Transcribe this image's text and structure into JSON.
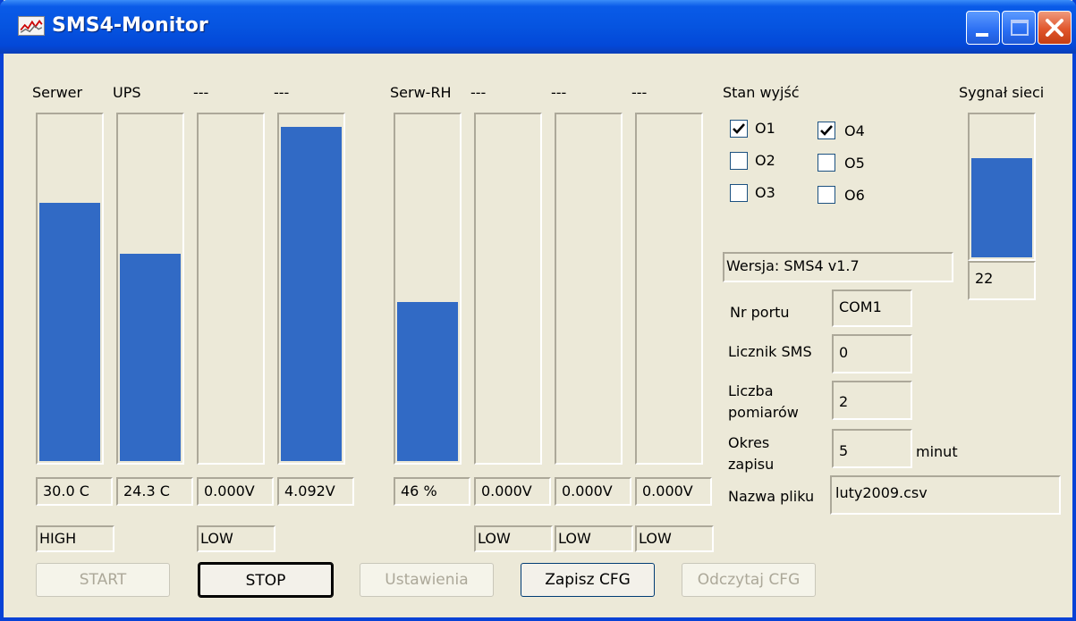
{
  "window": {
    "title": "SMS4-Monitor"
  },
  "channels": [
    {
      "label": "Serwer",
      "value": "30.0 C",
      "level": 0.75,
      "state": "HIGH"
    },
    {
      "label": "UPS",
      "value": "24.3 C",
      "level": 0.6,
      "state": ""
    },
    {
      "label": "---",
      "value": "0.000V",
      "level": 0.0,
      "state": "LOW"
    },
    {
      "label": "---",
      "value": "4.092V",
      "level": 0.97,
      "state": ""
    },
    {
      "label": "Serw-RH",
      "value": "46 %",
      "level": 0.46,
      "state": ""
    },
    {
      "label": "---",
      "value": "0.000V",
      "level": 0.0,
      "state": "LOW"
    },
    {
      "label": "---",
      "value": "0.000V",
      "level": 0.0,
      "state": "LOW"
    },
    {
      "label": "---",
      "value": "0.000V",
      "level": 0.0,
      "state": "LOW"
    }
  ],
  "outputs": {
    "label": "Stan wyjść",
    "items": [
      {
        "label": "O1",
        "checked": true
      },
      {
        "label": "O2",
        "checked": false
      },
      {
        "label": "O3",
        "checked": false
      },
      {
        "label": "O4",
        "checked": true
      },
      {
        "label": "O5",
        "checked": false
      },
      {
        "label": "O6",
        "checked": false
      }
    ]
  },
  "signal": {
    "label": "Sygnał sieci",
    "value": "22",
    "level": 0.7
  },
  "info": {
    "version": "Wersja: SMS4 v1.7",
    "port_label": "Nr portu",
    "port_value": "COM1",
    "sms_label": "Licznik SMS",
    "sms_value": "0",
    "meas_label_1": "Liczba",
    "meas_label_2": "pomiarów",
    "meas_value": "2",
    "period_label_1": "Okres",
    "period_label_2": "zapisu",
    "period_value": "5",
    "period_unit": "minut",
    "file_label": "Nazwa pliku",
    "file_value": "luty2009.csv"
  },
  "buttons": {
    "start": "START",
    "stop": "STOP",
    "settings": "Ustawienia",
    "save_cfg": "Zapisz CFG",
    "read_cfg": "Odczytaj CFG"
  },
  "colors": {
    "bar": "#316AC5",
    "title_bar": "#0654E0",
    "panel": "#ECE9D8"
  }
}
